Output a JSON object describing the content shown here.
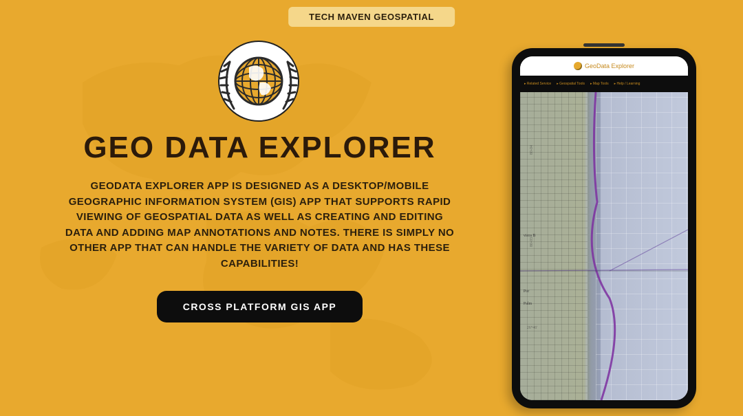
{
  "top_badge": "TECH MAVEN GEOSPATIAL",
  "title": "GEO DATA EXPLORER",
  "description": "GEODATA EXPLORER APP IS DESIGNED AS A DESKTOP/MOBILE GEOGRAPHIC INFORMATION SYSTEM (GIS) APP THAT SUPPORTS RAPID VIEWING OF GEOSPATIAL DATA AS WELL AS CREATING AND EDITING DATA AND ADDING MAP ANNOTATIONS AND NOTES. THERE IS SIMPLY NO OTHER APP THAT CAN HANDLE THE VARIETY OF DATA AND HAS THESE CAPABILITIES!",
  "cta_label": "CROSS PLATFORM GIS APP",
  "phone": {
    "app_name": "GeoData Explorer",
    "menu": {
      "item1": "▸ Related Service",
      "item2": "▸ Geospatial Tools",
      "item3": "▸ Map Tools",
      "item4": "▸ Help / Learning"
    },
    "map_labels": {
      "riviera": "viera B",
      "port": "Por",
      "palm": "Palm",
      "lat": "26°46'",
      "ymarks_top": "80-04",
      "ymarks_mid": "80-03"
    }
  },
  "colors": {
    "bg": "#e8a92e",
    "dark": "#0d0d0d",
    "badge_bg": "#f5d78a"
  }
}
